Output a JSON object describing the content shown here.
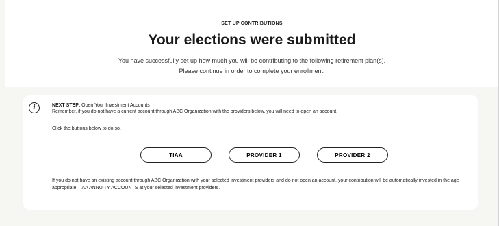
{
  "header": {
    "eyebrow": "SET UP CONTRIBUTIONS",
    "title": "Your elections were submitted",
    "subtitle": "You have successfully set up how much you will be contributing to the following retirement plan(s). Please continue in order to complete your enrollment."
  },
  "next_step": {
    "icon": "info-icon",
    "icon_glyph": "i",
    "label": "NEXT STEP:",
    "heading": " Open Your Investment Accounts",
    "remember": "Remember, if you do not have a current account through ABC Organization with the providers below, you will need to open an account.",
    "click_text": "Click the buttons below to do so.",
    "buttons": [
      "TIAA",
      "PROVIDER 1",
      "PROVIDER 2"
    ],
    "footnote": "If you do not have an existing account through ABC Organization with your selected investment providers and do not open an account, your contribution will be automatically invested in the age appropriate TIAA ANNUITY ACCOUNTS at your selected investment providers."
  },
  "colors": {
    "page_background": "#f6f7f2",
    "panel": "#ffffff",
    "text": "#1a1a1a",
    "border": "#222222"
  }
}
